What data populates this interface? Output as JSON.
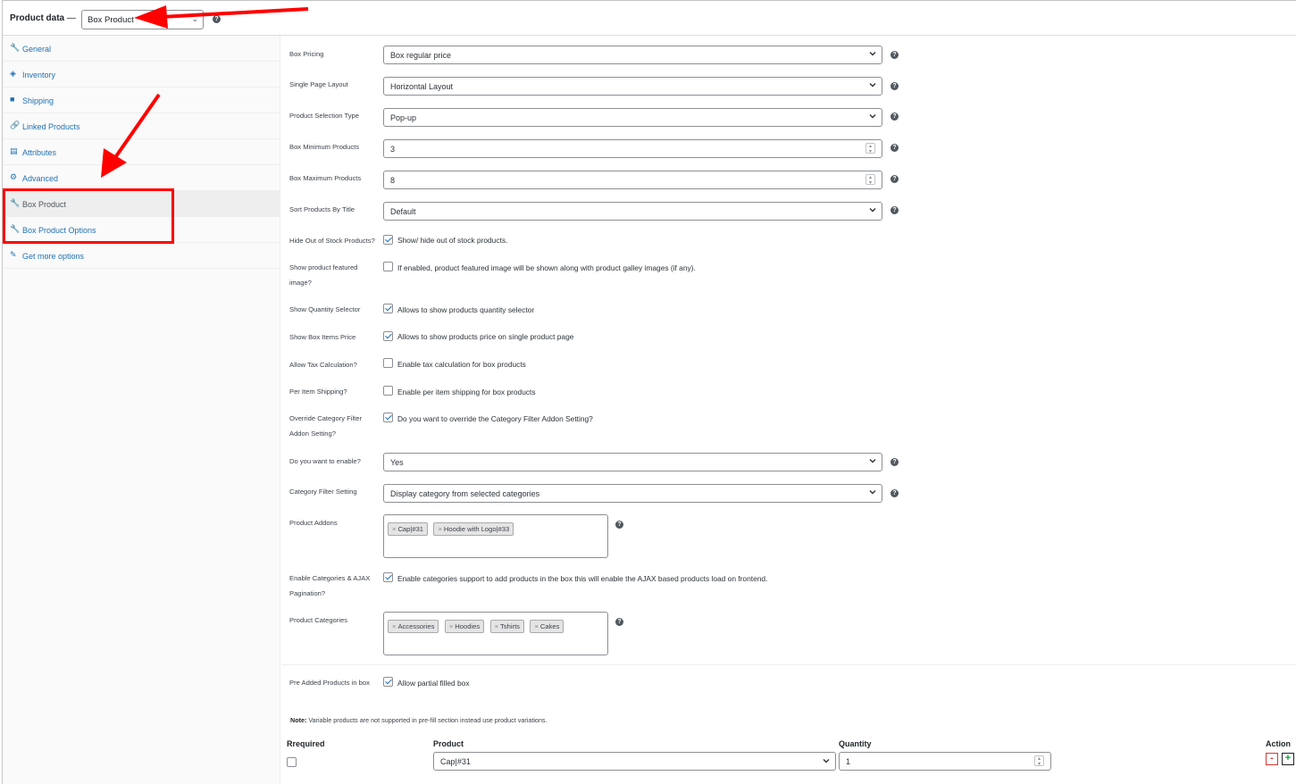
{
  "header": {
    "title": "Product data",
    "dash": "—",
    "product_type": "Box Product"
  },
  "sidebar": {
    "items": [
      {
        "label": "General",
        "icon": "wrench-icon",
        "glyph": "🔧"
      },
      {
        "label": "Inventory",
        "icon": "tag-icon",
        "glyph": "◈"
      },
      {
        "label": "Shipping",
        "icon": "truck-icon",
        "glyph": "■"
      },
      {
        "label": "Linked Products",
        "icon": "link-icon",
        "glyph": "🔗"
      },
      {
        "label": "Attributes",
        "icon": "list-icon",
        "glyph": "▤"
      },
      {
        "label": "Advanced",
        "icon": "gear-icon",
        "glyph": "⚙"
      },
      {
        "label": "Box Product",
        "icon": "wrench-icon",
        "glyph": "🔧"
      },
      {
        "label": "Box Product Options",
        "icon": "wrench-icon",
        "glyph": "🔧"
      },
      {
        "label": "Get more options",
        "icon": "plugin-icon",
        "glyph": "✎"
      }
    ]
  },
  "fields": {
    "box_pricing": {
      "label": "Box Pricing",
      "value": "Box regular price"
    },
    "single_page_layout": {
      "label": "Single Page Layout",
      "value": "Horizontal Layout"
    },
    "product_selection_type": {
      "label": "Product Selection Type",
      "value": "Pop-up"
    },
    "box_min": {
      "label": "Box Minimum Products",
      "value": "3"
    },
    "box_max": {
      "label": "Box Maximum Products",
      "value": "8"
    },
    "sort_by_title": {
      "label": "Sort Products By Title",
      "value": "Default"
    },
    "hide_out_of_stock": {
      "label": "Hide Out of Stock Products?",
      "text": "Show/ hide out of stock products.",
      "checked": true
    },
    "show_featured": {
      "label": "Show product featured image?",
      "text": "If enabled, product featured image will be shown along with product galley images (if any).",
      "checked": false
    },
    "show_qty_selector": {
      "label": "Show Quantity Selector",
      "text": "Allows to show products quantity selector",
      "checked": true
    },
    "show_items_price": {
      "label": "Show Box Items Price",
      "text": "Allows to show products price on single product page",
      "checked": true
    },
    "allow_tax": {
      "label": "Allow Tax Calculation?",
      "text": "Enable tax calculation for box products",
      "checked": false
    },
    "per_item_shipping": {
      "label": "Per Item Shipping?",
      "text": "Enable per item shipping for box products",
      "checked": false
    },
    "override_category_filter": {
      "label": "Override Category Filter Addon Setting?",
      "text": "Do you want to override the Category Filter Addon Setting?",
      "checked": true
    },
    "want_to_enable": {
      "label": "Do you want to enable?",
      "value": "Yes"
    },
    "category_filter_setting": {
      "label": "Category Filter Setting",
      "value": "Display category from selected categories"
    },
    "product_addons": {
      "label": "Product Addons",
      "tags": [
        "Cap|#31",
        "Hoodie with Logo|#33"
      ]
    },
    "enable_categories_ajax": {
      "label": "Enable Categories & AJAX Pagination?",
      "text": "Enable categories support to add products in the box this will enable the AJAX based products load on frontend.",
      "checked": true
    },
    "product_categories": {
      "label": "Product Categories",
      "tags": [
        "Accessories",
        "Hoodies",
        "Tshirts",
        "Cakes"
      ]
    },
    "pre_added": {
      "label": "Pre Added Products in box",
      "text": "Allow partial filled box",
      "checked": true
    }
  },
  "note": {
    "bold": "Note:",
    "text": " Variable products are not supported in pre-fill section instead use product variations."
  },
  "prefill_table": {
    "headers": {
      "required": "Rrequired",
      "product": "Product",
      "quantity": "Quantity",
      "action": "Action"
    },
    "row": {
      "required": false,
      "product": "Cap|#31",
      "quantity": "1"
    },
    "remove_symbol": "-",
    "add_symbol": "+"
  },
  "help_symbol": "?",
  "colors": {
    "annotation": "#ff0000",
    "link": "#2271b1"
  }
}
